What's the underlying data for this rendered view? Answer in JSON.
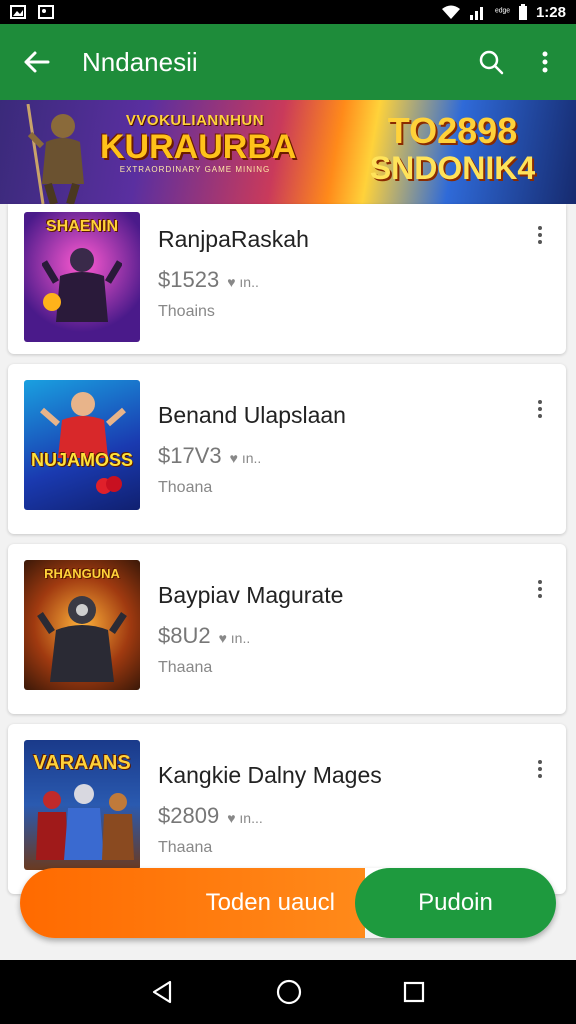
{
  "status_bar": {
    "time": "1:28",
    "signal_text": "ᵉᵈᵍᵉ"
  },
  "app_bar": {
    "title": "Nndanesii"
  },
  "banner": {
    "left_small": "VVOKULIANNHUN",
    "left_big": "KURAURBA",
    "left_tag": "EXTRAORDINARY GAME MINING",
    "right_line1": "TO2898",
    "right_line2": "SNDONIK4"
  },
  "items": [
    {
      "name": "RanjpaRaskah",
      "price": "$1523",
      "extra": "♥  ın..",
      "sub": "Thoains",
      "thumb_label": "SHAENIN"
    },
    {
      "name": "Benand Ulapslaan",
      "price": "$17V3",
      "extra": "♥  ın..",
      "sub": "Thoana",
      "thumb_label": "NUJAMOSS"
    },
    {
      "name": "Baypiav Magurate",
      "price": "$8U2",
      "extra": "♥  ın..",
      "sub": "Thaana",
      "thumb_label": "RHANGUNA"
    },
    {
      "name": "Kangkie Dalny Mages",
      "price": "$2809",
      "extra": "♥  ın...",
      "sub": "Thaana",
      "thumb_label": "VARAANS"
    }
  ],
  "cta": {
    "left_label": "Toden uaucl",
    "right_label": "Pudoin"
  },
  "colors": {
    "app_bar": "#1e8c3a",
    "cta_orange": "#ff7a10",
    "cta_green": "#1e9a3e"
  }
}
